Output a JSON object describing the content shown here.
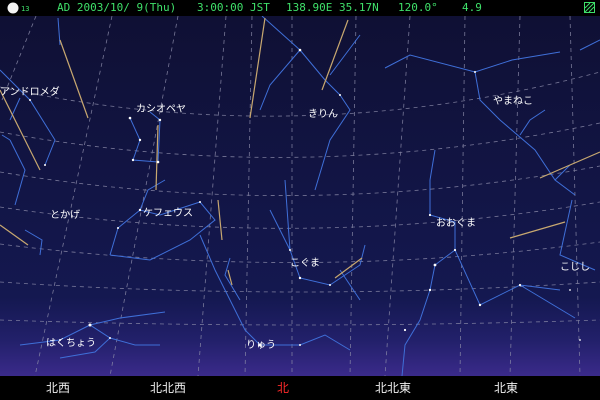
{
  "status": {
    "moon_age": "13",
    "date": "AD 2003/10/ 9(Thu)",
    "time": "3:00:00 JST",
    "location": "138.90E 35.17N",
    "field_of_view": "120.0°",
    "limiting_magnitude": "4.9",
    "grid_icon": "grid-toggle-icon",
    "text_color": "#3fe06a"
  },
  "constellations": [
    {
      "id": "andromeda",
      "label": "アンドロメダ"
    },
    {
      "id": "cassiopeia",
      "label": "カシオペヤ"
    },
    {
      "id": "camelopardalis",
      "label": "きりん"
    },
    {
      "id": "lynx",
      "label": "やまねこ"
    },
    {
      "id": "lacerta",
      "label": "とかげ"
    },
    {
      "id": "cepheus",
      "label": "ケフェウス"
    },
    {
      "id": "ursa-major",
      "label": "おおぐま"
    },
    {
      "id": "ursa-minor",
      "label": "こぐま"
    },
    {
      "id": "leo-minor",
      "label": "こじし"
    },
    {
      "id": "cygnus",
      "label": "はくちょう"
    },
    {
      "id": "draco",
      "label": "りゅう"
    }
  ],
  "directions": [
    {
      "label": "北西"
    },
    {
      "label": "北北西"
    },
    {
      "label": "北"
    },
    {
      "label": "北北東"
    },
    {
      "label": "北東"
    }
  ],
  "colors": {
    "sky_top": "#0f1034",
    "sky_horizon": "#3a2a8a",
    "constellation_line": "#3f6fd8",
    "grid_line": "#8a8aa8",
    "meteor_trail": "#c8a870",
    "north_label": "#ff2a2a"
  }
}
